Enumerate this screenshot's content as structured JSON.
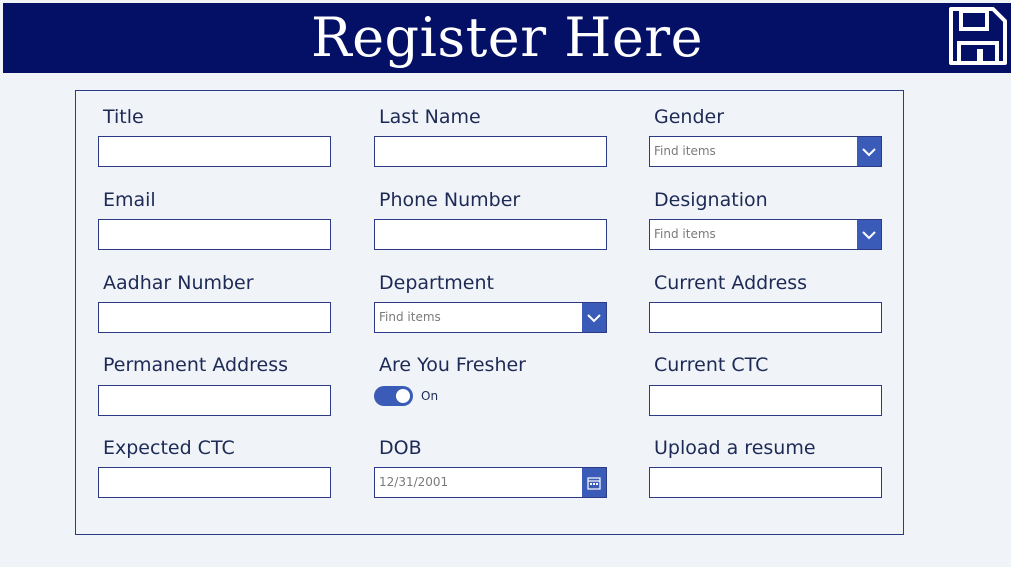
{
  "header": {
    "title": "Register Here",
    "icon": "save-icon",
    "background": "#031065"
  },
  "form": {
    "title_label": "Title",
    "last_name_label": "Last Name",
    "gender_label": "Gender",
    "gender_placeholder": "Find items",
    "email_label": "Email",
    "phone_label": "Phone Number",
    "designation_label": "Designation",
    "designation_placeholder": "Find items",
    "aadhar_label": "Aadhar Number",
    "department_label": "Department",
    "department_placeholder": "Find items",
    "current_address_label": "Current Address",
    "permanent_address_label": "Permanent Address",
    "fresher_label": "Are You Fresher",
    "fresher_state": "On",
    "current_ctc_label": "Current CTC",
    "expected_ctc_label": "Expected CTC",
    "dob_label": "DOB",
    "dob_value": "12/31/2001",
    "resume_label": "Upload a resume"
  },
  "colors": {
    "accent": "#3a5bb8",
    "border": "#2c3a85",
    "background": "#f0f3f8"
  }
}
